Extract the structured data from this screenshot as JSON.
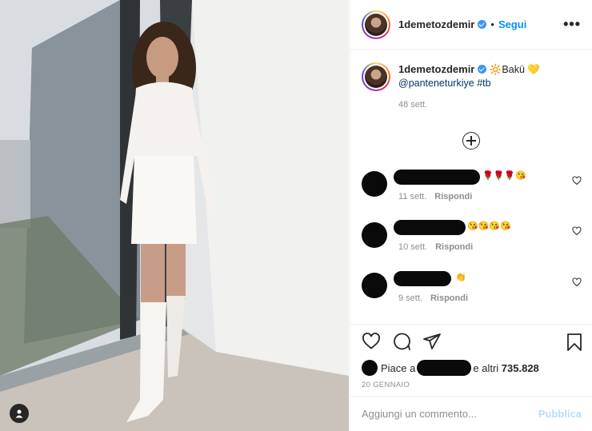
{
  "post": {
    "username": "1demetozdemir",
    "follow_label": "Segui",
    "dot": "•",
    "more_label": "•••"
  },
  "caption": {
    "username": "1demetozdemir",
    "text_pre": "🔆Bakü 💛",
    "mention": "@panteneturkiye",
    "hashtag": "#tb",
    "time": "48 sett."
  },
  "comments": [
    {
      "emoji": "🌹🌹🌹😘",
      "time": "11 sett.",
      "reply": "Rispondi"
    },
    {
      "emoji": "😘😘😘😘",
      "time": "10 sett.",
      "reply": "Rispondi"
    },
    {
      "emoji": "👏",
      "time": "9 sett.",
      "reply": "Rispondi"
    }
  ],
  "likes": {
    "prefix": "Piace a",
    "suffix": "e altri",
    "count": "735.828"
  },
  "date": "20 GENNAIO",
  "add_comment": {
    "placeholder": "Aggiungi un commento...",
    "publish_label": "Pubblica"
  },
  "icons": {
    "like": "heart-icon",
    "comment": "comment-icon",
    "share": "share-icon",
    "save": "bookmark-icon",
    "add": "plus-circle-icon",
    "tag": "user-tag-icon"
  },
  "colors": {
    "accent": "#0095f6",
    "verified": "#3897f0",
    "muted": "#8e8e8e",
    "publish_disabled": "#b2dffc"
  }
}
